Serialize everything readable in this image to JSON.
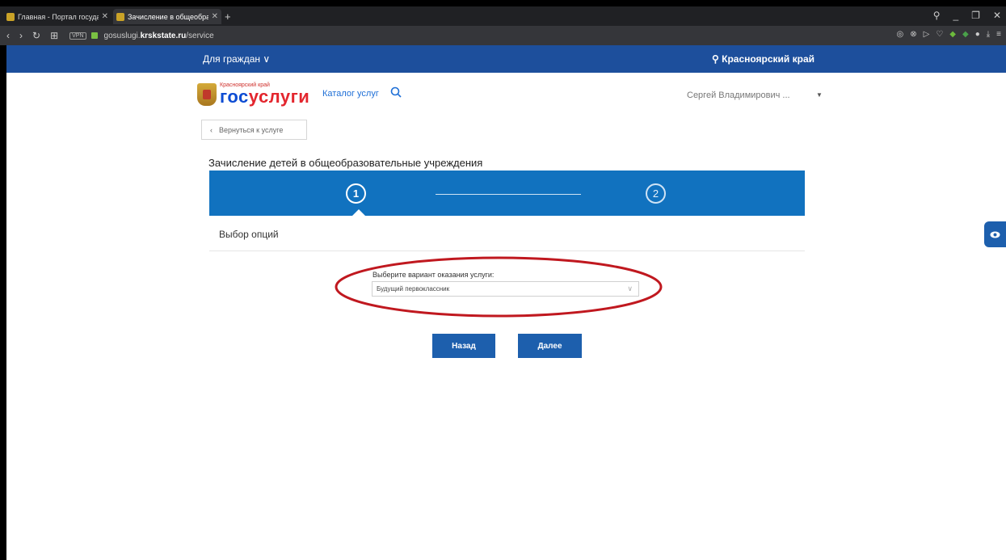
{
  "browser": {
    "tabs": [
      {
        "title": "Главная - Портал государ",
        "close": "✕"
      },
      {
        "title": "Зачисление в общеобраз",
        "close": "✕"
      }
    ],
    "new_tab": "+",
    "url_host": "gosuslugi.",
    "url_host_bold": "krskstate.ru",
    "url_path": "/service",
    "vpn": "VPN",
    "window_controls": [
      "⚲",
      "_",
      "❐",
      "✕"
    ]
  },
  "topbar": {
    "for_citizens": "Для граждан ∨",
    "region": "Красноярский край"
  },
  "header": {
    "logo_sub": "Красноярский край",
    "logo_main_a": "гос",
    "logo_main_b": "услуги",
    "catalog": "Каталог услуг",
    "user": "Сергей Владимирович ...",
    "user_caret": "▼"
  },
  "back_button": "Вернуться к услуге",
  "service_title": "Зачисление детей в общеобразовательные учреждения",
  "stepper": {
    "step1": "1",
    "step2": "2",
    "current_step": 1
  },
  "section_title": "Выбор опций",
  "form": {
    "label": "Выберите вариант оказания услуги:",
    "selected": "Будущий первоклассник"
  },
  "buttons": {
    "back": "Назад",
    "next": "Далее"
  },
  "colors": {
    "brand_blue": "#1d4f9c",
    "stepper_blue": "#1172bf",
    "button_blue": "#1d5fad",
    "annotation_red": "#c0181f"
  }
}
